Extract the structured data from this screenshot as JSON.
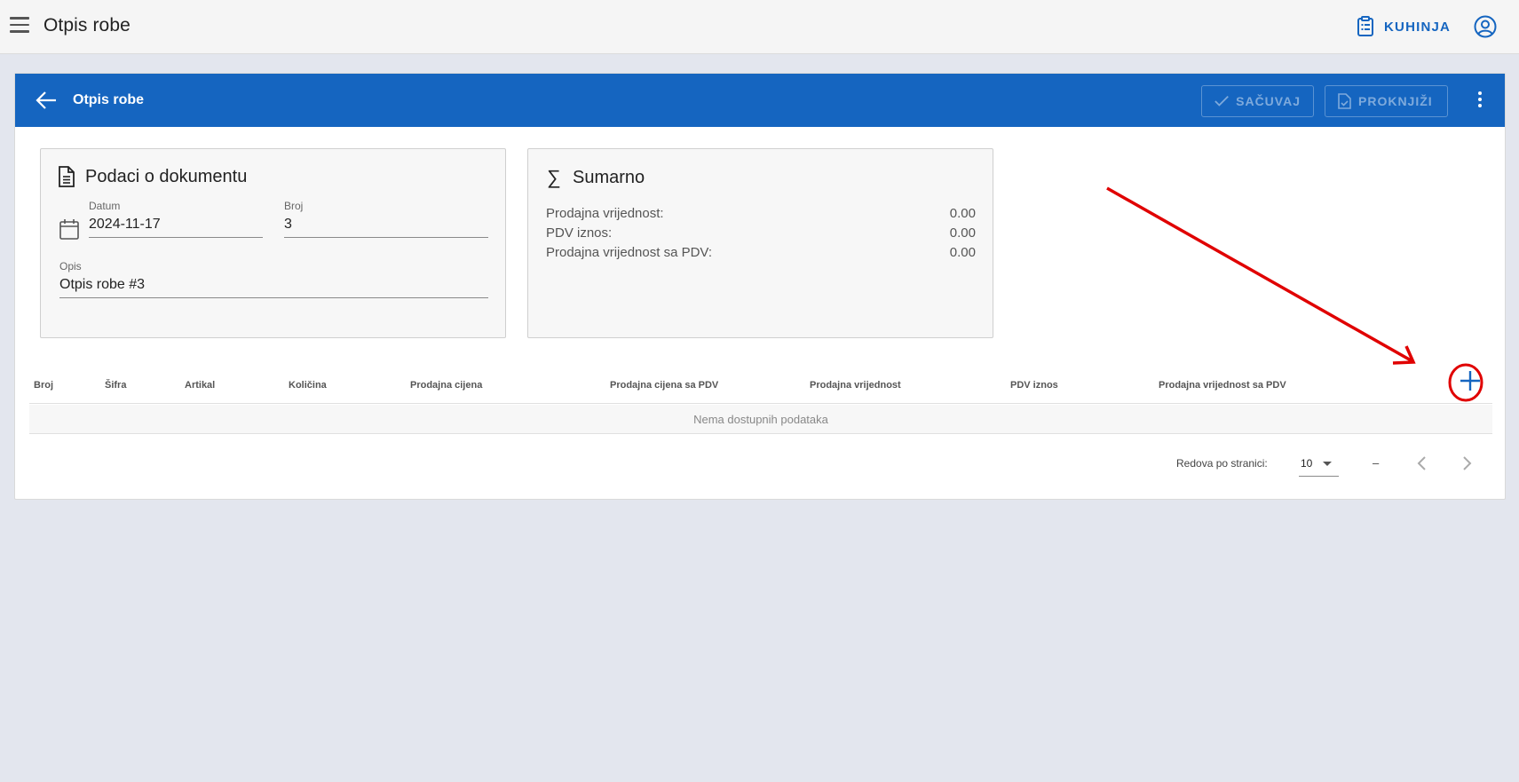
{
  "appbar": {
    "title": "Otpis robe",
    "location_label": "KUHINJA",
    "icons": {
      "menu": "hamburger-menu-icon",
      "location": "clipboard-list-icon",
      "account": "account-circle-icon"
    }
  },
  "card": {
    "title": "Otpis robe",
    "save_label": "SAČUVAJ",
    "post_label": "PROKNJIŽI",
    "header_color": "#1565c0"
  },
  "document": {
    "heading": "Podaci o dokumentu",
    "date_label": "Datum",
    "date_value": "2024-11-17",
    "number_label": "Broj",
    "number_value": "3",
    "description_label": "Opis",
    "description_value": "Otpis robe #3"
  },
  "summary": {
    "heading": "Sumarno",
    "rows": [
      {
        "label": "Prodajna vrijednost:",
        "value": "0.00"
      },
      {
        "label": "PDV iznos:",
        "value": "0.00"
      },
      {
        "label": "Prodajna vrijednost sa PDV:",
        "value": "0.00"
      }
    ]
  },
  "table": {
    "columns": [
      "Broj",
      "Šifra",
      "Artikal",
      "Količina",
      "Prodajna cijena",
      "Prodajna cijena sa PDV",
      "Prodajna vrijednost",
      "PDV iznos",
      "Prodajna vrijednost sa PDV"
    ],
    "empty_text": "Nema dostupnih podataka"
  },
  "pagination": {
    "rows_per_page_label": "Redova po stranici:",
    "rows_per_page_value": "10",
    "range_text": "–"
  },
  "annotation_color": "#e00000"
}
